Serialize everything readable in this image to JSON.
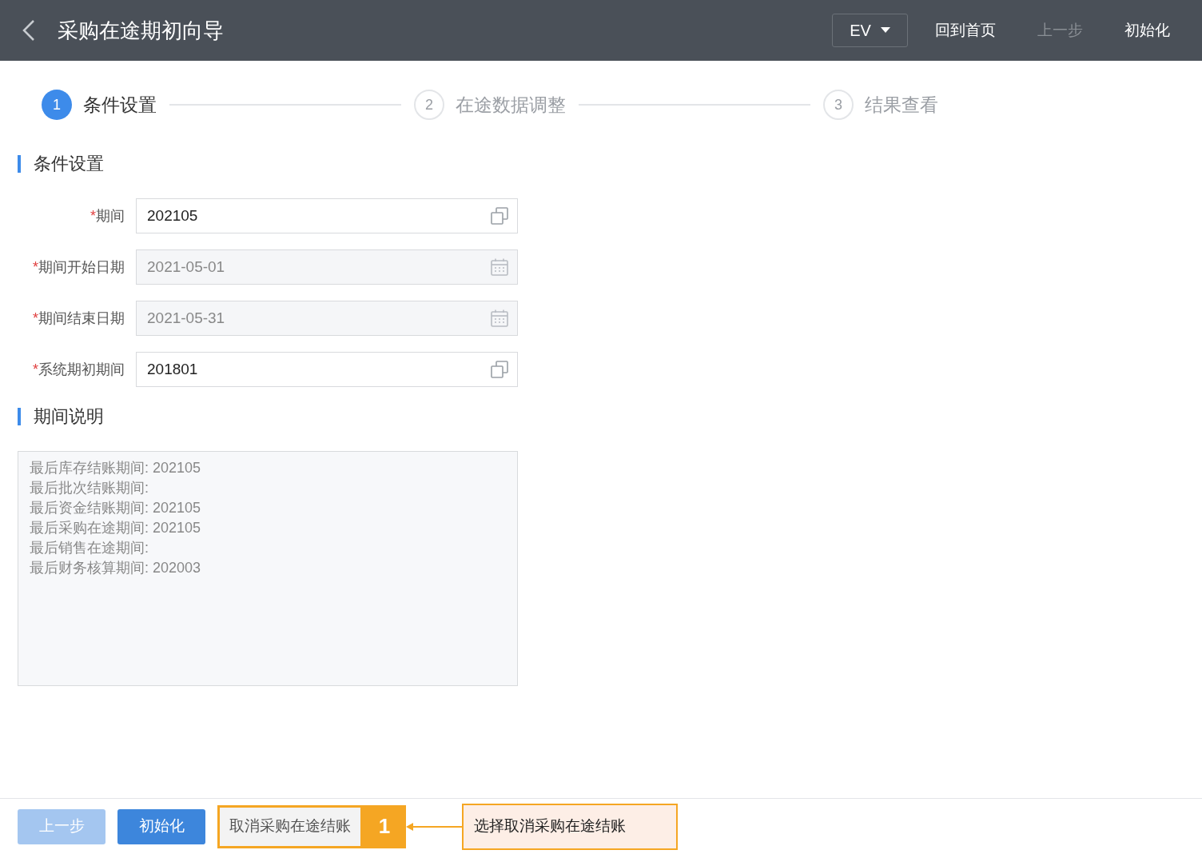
{
  "header": {
    "title": "采购在途期初向导",
    "menu_button": "EV",
    "actions": [
      {
        "label": "回到首页",
        "disabled": false
      },
      {
        "label": "上一步",
        "disabled": true
      },
      {
        "label": "初始化",
        "disabled": false
      }
    ]
  },
  "steps": [
    {
      "number": "1",
      "label": "条件设置",
      "selected": true
    },
    {
      "number": "2",
      "label": "在途数据调整",
      "selected": false
    },
    {
      "number": "3",
      "label": "结果查看",
      "selected": false
    }
  ],
  "conditions": {
    "heading": "条件设置",
    "fields": [
      {
        "label": "期间",
        "required_mark": "*",
        "value": "202105",
        "disabled": false,
        "kind": "lookup"
      },
      {
        "label": "期间开始日期",
        "required_mark": "*",
        "value": "2021-05-01",
        "disabled": true,
        "kind": "date"
      },
      {
        "label": "期间结束日期",
        "required_mark": "*",
        "value": "2021-05-31",
        "disabled": true,
        "kind": "date"
      },
      {
        "label": "系统期初期间",
        "required_mark": "*",
        "value": "201801",
        "disabled": false,
        "kind": "lookup"
      }
    ]
  },
  "period_notes": {
    "heading": "期间说明",
    "lines": [
      "最后库存结账期间: 202105",
      "最后批次结账期间:",
      "最后资金结账期间: 202105",
      "最后采购在途期间: 202105",
      "最后销售在途期间:",
      "最后财务核算期间: 202003"
    ]
  },
  "footer_buttons": [
    {
      "label": "上一步",
      "kind": "primary",
      "disabled": true
    },
    {
      "label": "初始化",
      "kind": "primary",
      "disabled": false
    },
    {
      "label": "取消采购在途结账",
      "kind": "default",
      "disabled": false
    }
  ],
  "annotation": {
    "number": "1",
    "text": "选择取消采购在途结账"
  }
}
